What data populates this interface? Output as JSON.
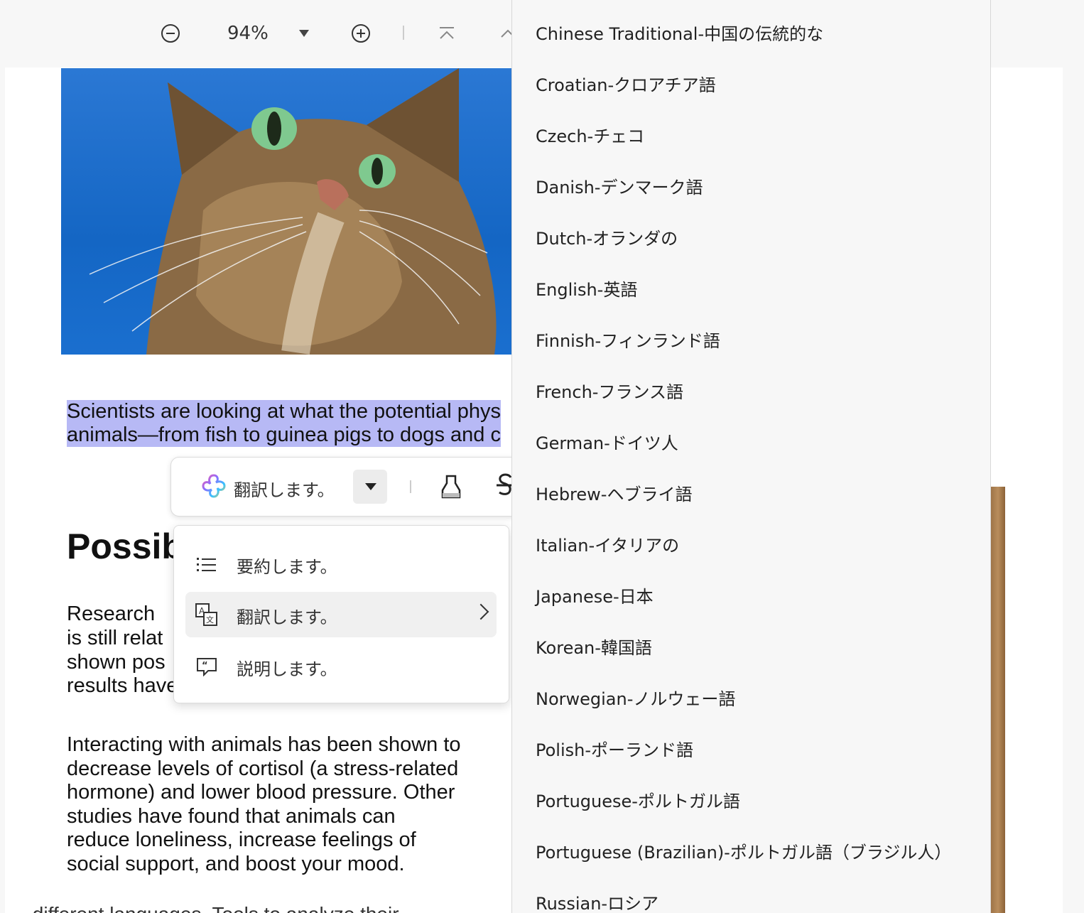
{
  "toolbar": {
    "zoom_value": "94%",
    "icons": [
      "zoom-out-icon",
      "zoom-dropdown-icon",
      "zoom-in-icon",
      "first-page-icon",
      "previous-page-icon"
    ]
  },
  "document": {
    "selected_lines": [
      "Scientists are looking at what the potential phys",
      "animals—from fish to guinea pigs to dogs and c"
    ],
    "heading": "Possib",
    "para1_lines": [
      "Research",
      "is still  relat",
      "shown  pos",
      "results have"
    ],
    "para2_lines": [
      "Interacting with animals has been shown to",
      "decrease levels of cortisol (a stress-related",
      "hormone) and lower blood pressure. Other",
      "studies have found that animals can",
      "reduce loneliness,  increase  feelings  of",
      "social support, and boost your mood."
    ],
    "cut_line": "… different languages. Tools to analyze their…",
    "image_desc_icon": "cat-photo"
  },
  "ai_toolbar": {
    "label": "翻訳します。",
    "icons": [
      "ai-logo-icon",
      "dropdown-icon",
      "highlighter-icon",
      "strikethrough-icon"
    ]
  },
  "ai_menu": {
    "items": [
      {
        "label": "要約します。",
        "icon": "list-icon",
        "active": false
      },
      {
        "label": "翻訳します。",
        "icon": "translate-icon",
        "active": true
      },
      {
        "label": "説明します。",
        "icon": "explain-icon",
        "active": false
      }
    ]
  },
  "languages": [
    "Chinese Traditional-中国の伝統的な",
    "Croatian-クロアチア語",
    "Czech-チェコ",
    "Danish-デンマーク語",
    "Dutch-オランダの",
    "English-英語",
    "Finnish-フィンランド語",
    "French-フランス語",
    "German-ドイツ人",
    "Hebrew-ヘブライ語",
    "Italian-イタリアの",
    "Japanese-日本",
    "Korean-韓国語",
    "Norwegian-ノルウェー語",
    "Polish-ポーランド語",
    "Portuguese-ポルトガル語",
    "Portuguese (Brazilian)-ポルトガル語（ブラジル人）",
    "Russian-ロシア"
  ],
  "colors": {
    "selection": "#b7b9f5",
    "panel_bg": "#f7f7f7"
  }
}
